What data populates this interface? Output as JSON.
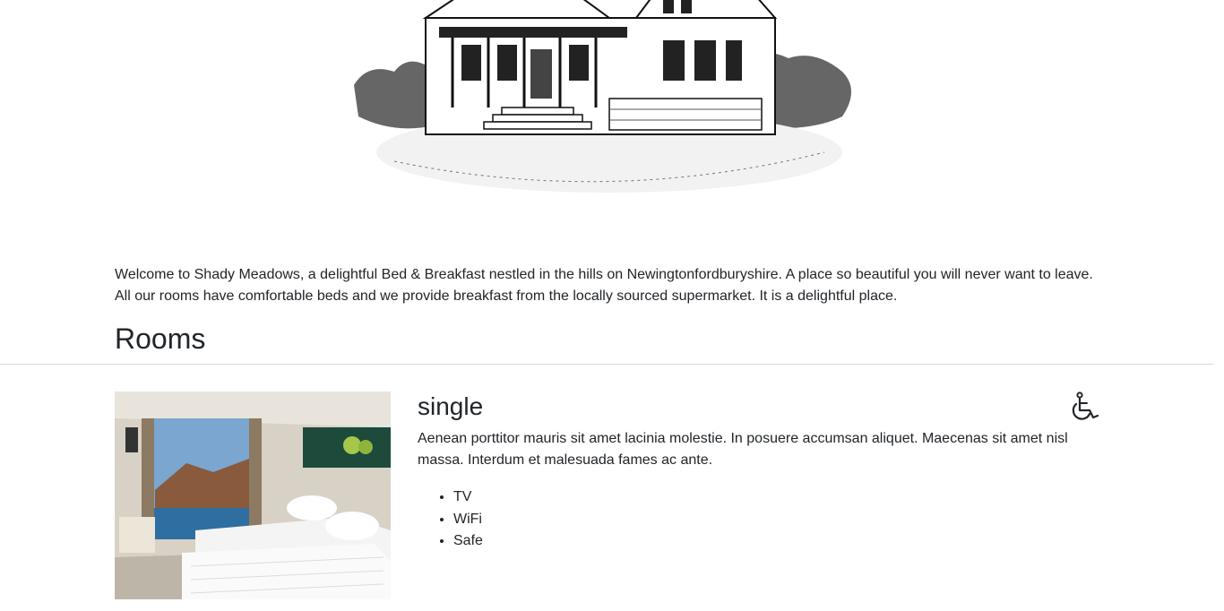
{
  "hero": {
    "image": "bed-and-breakfast-house-sketch"
  },
  "intro": {
    "text": "Welcome to Shady Meadows, a delightful Bed & Breakfast nestled in the hills on Newingtonfordburyshire. A place so beautiful you will never want to leave. All our rooms have comfortable beds and we provide breakfast from the locally sourced supermarket. It is a delightful place."
  },
  "rooms": {
    "heading": "Rooms",
    "items": [
      {
        "type": "single",
        "accessible_icon": "wheelchair-icon",
        "photo": "hotel-room-photo",
        "description": "Aenean porttitor mauris sit amet lacinia molestie. In posuere accumsan aliquet. Maecenas sit amet nisl massa. Interdum et malesuada fames ac ante.",
        "features": [
          "TV",
          "WiFi",
          "Safe"
        ]
      }
    ]
  },
  "colors": {
    "text": "#212529",
    "divider": "#d9d9d9",
    "background": "#ffffff"
  }
}
